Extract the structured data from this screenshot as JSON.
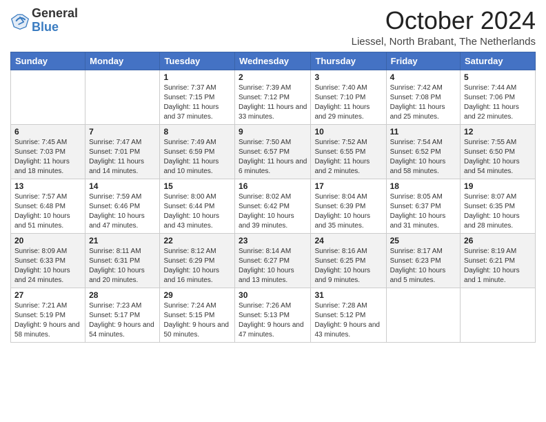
{
  "logo": {
    "general": "General",
    "blue": "Blue"
  },
  "header": {
    "title": "October 2024",
    "subtitle": "Liessel, North Brabant, The Netherlands"
  },
  "weekdays": [
    "Sunday",
    "Monday",
    "Tuesday",
    "Wednesday",
    "Thursday",
    "Friday",
    "Saturday"
  ],
  "weeks": [
    [
      {
        "day": "",
        "sunrise": "",
        "sunset": "",
        "daylight": ""
      },
      {
        "day": "",
        "sunrise": "",
        "sunset": "",
        "daylight": ""
      },
      {
        "day": "1",
        "sunrise": "Sunrise: 7:37 AM",
        "sunset": "Sunset: 7:15 PM",
        "daylight": "Daylight: 11 hours and 37 minutes."
      },
      {
        "day": "2",
        "sunrise": "Sunrise: 7:39 AM",
        "sunset": "Sunset: 7:12 PM",
        "daylight": "Daylight: 11 hours and 33 minutes."
      },
      {
        "day": "3",
        "sunrise": "Sunrise: 7:40 AM",
        "sunset": "Sunset: 7:10 PM",
        "daylight": "Daylight: 11 hours and 29 minutes."
      },
      {
        "day": "4",
        "sunrise": "Sunrise: 7:42 AM",
        "sunset": "Sunset: 7:08 PM",
        "daylight": "Daylight: 11 hours and 25 minutes."
      },
      {
        "day": "5",
        "sunrise": "Sunrise: 7:44 AM",
        "sunset": "Sunset: 7:06 PM",
        "daylight": "Daylight: 11 hours and 22 minutes."
      }
    ],
    [
      {
        "day": "6",
        "sunrise": "Sunrise: 7:45 AM",
        "sunset": "Sunset: 7:03 PM",
        "daylight": "Daylight: 11 hours and 18 minutes."
      },
      {
        "day": "7",
        "sunrise": "Sunrise: 7:47 AM",
        "sunset": "Sunset: 7:01 PM",
        "daylight": "Daylight: 11 hours and 14 minutes."
      },
      {
        "day": "8",
        "sunrise": "Sunrise: 7:49 AM",
        "sunset": "Sunset: 6:59 PM",
        "daylight": "Daylight: 11 hours and 10 minutes."
      },
      {
        "day": "9",
        "sunrise": "Sunrise: 7:50 AM",
        "sunset": "Sunset: 6:57 PM",
        "daylight": "Daylight: 11 hours and 6 minutes."
      },
      {
        "day": "10",
        "sunrise": "Sunrise: 7:52 AM",
        "sunset": "Sunset: 6:55 PM",
        "daylight": "Daylight: 11 hours and 2 minutes."
      },
      {
        "day": "11",
        "sunrise": "Sunrise: 7:54 AM",
        "sunset": "Sunset: 6:52 PM",
        "daylight": "Daylight: 10 hours and 58 minutes."
      },
      {
        "day": "12",
        "sunrise": "Sunrise: 7:55 AM",
        "sunset": "Sunset: 6:50 PM",
        "daylight": "Daylight: 10 hours and 54 minutes."
      }
    ],
    [
      {
        "day": "13",
        "sunrise": "Sunrise: 7:57 AM",
        "sunset": "Sunset: 6:48 PM",
        "daylight": "Daylight: 10 hours and 51 minutes."
      },
      {
        "day": "14",
        "sunrise": "Sunrise: 7:59 AM",
        "sunset": "Sunset: 6:46 PM",
        "daylight": "Daylight: 10 hours and 47 minutes."
      },
      {
        "day": "15",
        "sunrise": "Sunrise: 8:00 AM",
        "sunset": "Sunset: 6:44 PM",
        "daylight": "Daylight: 10 hours and 43 minutes."
      },
      {
        "day": "16",
        "sunrise": "Sunrise: 8:02 AM",
        "sunset": "Sunset: 6:42 PM",
        "daylight": "Daylight: 10 hours and 39 minutes."
      },
      {
        "day": "17",
        "sunrise": "Sunrise: 8:04 AM",
        "sunset": "Sunset: 6:39 PM",
        "daylight": "Daylight: 10 hours and 35 minutes."
      },
      {
        "day": "18",
        "sunrise": "Sunrise: 8:05 AM",
        "sunset": "Sunset: 6:37 PM",
        "daylight": "Daylight: 10 hours and 31 minutes."
      },
      {
        "day": "19",
        "sunrise": "Sunrise: 8:07 AM",
        "sunset": "Sunset: 6:35 PM",
        "daylight": "Daylight: 10 hours and 28 minutes."
      }
    ],
    [
      {
        "day": "20",
        "sunrise": "Sunrise: 8:09 AM",
        "sunset": "Sunset: 6:33 PM",
        "daylight": "Daylight: 10 hours and 24 minutes."
      },
      {
        "day": "21",
        "sunrise": "Sunrise: 8:11 AM",
        "sunset": "Sunset: 6:31 PM",
        "daylight": "Daylight: 10 hours and 20 minutes."
      },
      {
        "day": "22",
        "sunrise": "Sunrise: 8:12 AM",
        "sunset": "Sunset: 6:29 PM",
        "daylight": "Daylight: 10 hours and 16 minutes."
      },
      {
        "day": "23",
        "sunrise": "Sunrise: 8:14 AM",
        "sunset": "Sunset: 6:27 PM",
        "daylight": "Daylight: 10 hours and 13 minutes."
      },
      {
        "day": "24",
        "sunrise": "Sunrise: 8:16 AM",
        "sunset": "Sunset: 6:25 PM",
        "daylight": "Daylight: 10 hours and 9 minutes."
      },
      {
        "day": "25",
        "sunrise": "Sunrise: 8:17 AM",
        "sunset": "Sunset: 6:23 PM",
        "daylight": "Daylight: 10 hours and 5 minutes."
      },
      {
        "day": "26",
        "sunrise": "Sunrise: 8:19 AM",
        "sunset": "Sunset: 6:21 PM",
        "daylight": "Daylight: 10 hours and 1 minute."
      }
    ],
    [
      {
        "day": "27",
        "sunrise": "Sunrise: 7:21 AM",
        "sunset": "Sunset: 5:19 PM",
        "daylight": "Daylight: 9 hours and 58 minutes."
      },
      {
        "day": "28",
        "sunrise": "Sunrise: 7:23 AM",
        "sunset": "Sunset: 5:17 PM",
        "daylight": "Daylight: 9 hours and 54 minutes."
      },
      {
        "day": "29",
        "sunrise": "Sunrise: 7:24 AM",
        "sunset": "Sunset: 5:15 PM",
        "daylight": "Daylight: 9 hours and 50 minutes."
      },
      {
        "day": "30",
        "sunrise": "Sunrise: 7:26 AM",
        "sunset": "Sunset: 5:13 PM",
        "daylight": "Daylight: 9 hours and 47 minutes."
      },
      {
        "day": "31",
        "sunrise": "Sunrise: 7:28 AM",
        "sunset": "Sunset: 5:12 PM",
        "daylight": "Daylight: 9 hours and 43 minutes."
      },
      {
        "day": "",
        "sunrise": "",
        "sunset": "",
        "daylight": ""
      },
      {
        "day": "",
        "sunrise": "",
        "sunset": "",
        "daylight": ""
      }
    ]
  ]
}
